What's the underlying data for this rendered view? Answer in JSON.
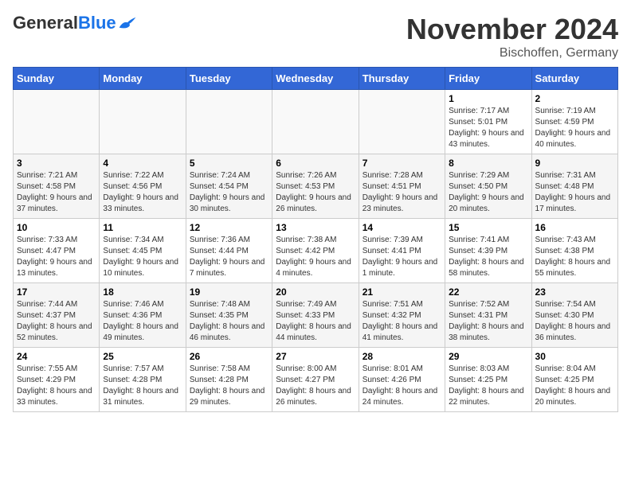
{
  "logo": {
    "general": "General",
    "blue": "Blue"
  },
  "title": "November 2024",
  "location": "Bischoffen, Germany",
  "weekdays": [
    "Sunday",
    "Monday",
    "Tuesday",
    "Wednesday",
    "Thursday",
    "Friday",
    "Saturday"
  ],
  "weeks": [
    [
      {
        "day": "",
        "info": ""
      },
      {
        "day": "",
        "info": ""
      },
      {
        "day": "",
        "info": ""
      },
      {
        "day": "",
        "info": ""
      },
      {
        "day": "",
        "info": ""
      },
      {
        "day": "1",
        "info": "Sunrise: 7:17 AM\nSunset: 5:01 PM\nDaylight: 9 hours and 43 minutes."
      },
      {
        "day": "2",
        "info": "Sunrise: 7:19 AM\nSunset: 4:59 PM\nDaylight: 9 hours and 40 minutes."
      }
    ],
    [
      {
        "day": "3",
        "info": "Sunrise: 7:21 AM\nSunset: 4:58 PM\nDaylight: 9 hours and 37 minutes."
      },
      {
        "day": "4",
        "info": "Sunrise: 7:22 AM\nSunset: 4:56 PM\nDaylight: 9 hours and 33 minutes."
      },
      {
        "day": "5",
        "info": "Sunrise: 7:24 AM\nSunset: 4:54 PM\nDaylight: 9 hours and 30 minutes."
      },
      {
        "day": "6",
        "info": "Sunrise: 7:26 AM\nSunset: 4:53 PM\nDaylight: 9 hours and 26 minutes."
      },
      {
        "day": "7",
        "info": "Sunrise: 7:28 AM\nSunset: 4:51 PM\nDaylight: 9 hours and 23 minutes."
      },
      {
        "day": "8",
        "info": "Sunrise: 7:29 AM\nSunset: 4:50 PM\nDaylight: 9 hours and 20 minutes."
      },
      {
        "day": "9",
        "info": "Sunrise: 7:31 AM\nSunset: 4:48 PM\nDaylight: 9 hours and 17 minutes."
      }
    ],
    [
      {
        "day": "10",
        "info": "Sunrise: 7:33 AM\nSunset: 4:47 PM\nDaylight: 9 hours and 13 minutes."
      },
      {
        "day": "11",
        "info": "Sunrise: 7:34 AM\nSunset: 4:45 PM\nDaylight: 9 hours and 10 minutes."
      },
      {
        "day": "12",
        "info": "Sunrise: 7:36 AM\nSunset: 4:44 PM\nDaylight: 9 hours and 7 minutes."
      },
      {
        "day": "13",
        "info": "Sunrise: 7:38 AM\nSunset: 4:42 PM\nDaylight: 9 hours and 4 minutes."
      },
      {
        "day": "14",
        "info": "Sunrise: 7:39 AM\nSunset: 4:41 PM\nDaylight: 9 hours and 1 minute."
      },
      {
        "day": "15",
        "info": "Sunrise: 7:41 AM\nSunset: 4:39 PM\nDaylight: 8 hours and 58 minutes."
      },
      {
        "day": "16",
        "info": "Sunrise: 7:43 AM\nSunset: 4:38 PM\nDaylight: 8 hours and 55 minutes."
      }
    ],
    [
      {
        "day": "17",
        "info": "Sunrise: 7:44 AM\nSunset: 4:37 PM\nDaylight: 8 hours and 52 minutes."
      },
      {
        "day": "18",
        "info": "Sunrise: 7:46 AM\nSunset: 4:36 PM\nDaylight: 8 hours and 49 minutes."
      },
      {
        "day": "19",
        "info": "Sunrise: 7:48 AM\nSunset: 4:35 PM\nDaylight: 8 hours and 46 minutes."
      },
      {
        "day": "20",
        "info": "Sunrise: 7:49 AM\nSunset: 4:33 PM\nDaylight: 8 hours and 44 minutes."
      },
      {
        "day": "21",
        "info": "Sunrise: 7:51 AM\nSunset: 4:32 PM\nDaylight: 8 hours and 41 minutes."
      },
      {
        "day": "22",
        "info": "Sunrise: 7:52 AM\nSunset: 4:31 PM\nDaylight: 8 hours and 38 minutes."
      },
      {
        "day": "23",
        "info": "Sunrise: 7:54 AM\nSunset: 4:30 PM\nDaylight: 8 hours and 36 minutes."
      }
    ],
    [
      {
        "day": "24",
        "info": "Sunrise: 7:55 AM\nSunset: 4:29 PM\nDaylight: 8 hours and 33 minutes."
      },
      {
        "day": "25",
        "info": "Sunrise: 7:57 AM\nSunset: 4:28 PM\nDaylight: 8 hours and 31 minutes."
      },
      {
        "day": "26",
        "info": "Sunrise: 7:58 AM\nSunset: 4:28 PM\nDaylight: 8 hours and 29 minutes."
      },
      {
        "day": "27",
        "info": "Sunrise: 8:00 AM\nSunset: 4:27 PM\nDaylight: 8 hours and 26 minutes."
      },
      {
        "day": "28",
        "info": "Sunrise: 8:01 AM\nSunset: 4:26 PM\nDaylight: 8 hours and 24 minutes."
      },
      {
        "day": "29",
        "info": "Sunrise: 8:03 AM\nSunset: 4:25 PM\nDaylight: 8 hours and 22 minutes."
      },
      {
        "day": "30",
        "info": "Sunrise: 8:04 AM\nSunset: 4:25 PM\nDaylight: 8 hours and 20 minutes."
      }
    ]
  ]
}
